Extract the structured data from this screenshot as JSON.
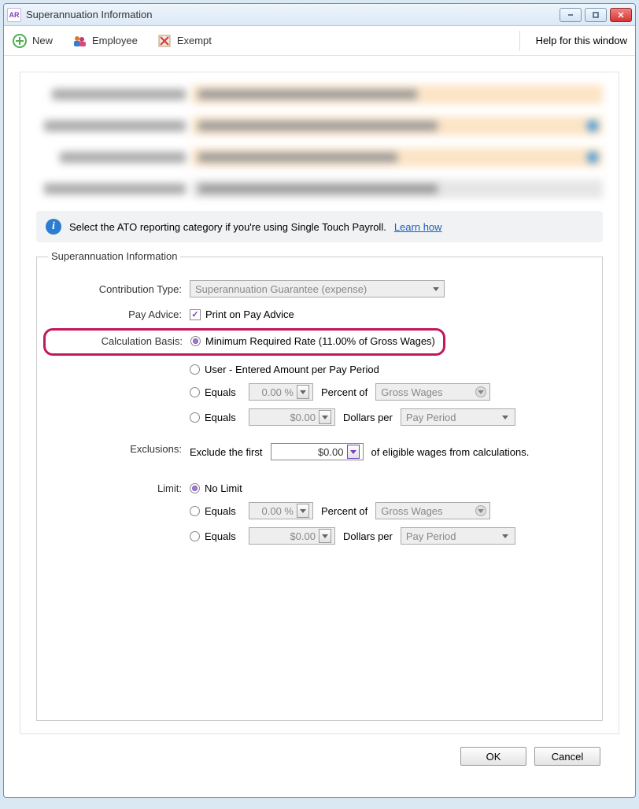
{
  "window": {
    "title": "Superannuation Information",
    "appicon": "AR"
  },
  "toolbar": {
    "new_label": "New",
    "employee_label": "Employee",
    "exempt_label": "Exempt",
    "help_label": "Help for this window"
  },
  "info": {
    "text": "Select the ATO reporting category if you're using Single Touch Payroll.",
    "link": "Learn how"
  },
  "section": {
    "legend": "Superannuation Information",
    "contribution_type_label": "Contribution Type:",
    "contribution_type_value": "Superannuation Guarantee (expense)",
    "pay_advice_label": "Pay Advice:",
    "print_on_pay_advice": "Print on Pay Advice",
    "calc_basis_label": "Calculation Basis:",
    "calc_min_rate": "Minimum Required Rate (11.00% of Gross Wages)",
    "calc_user_entered": "User - Entered Amount per Pay Period",
    "equals": "Equals",
    "percent_value": "0.00 %",
    "percent_of": "Percent of",
    "gross_wages": "Gross Wages",
    "dollars_value": "$0.00",
    "dollars_per": "Dollars per",
    "pay_period": "Pay Period",
    "exclusions_label": "Exclusions:",
    "exclusions_pre": "Exclude the first",
    "exclusions_value": "$0.00",
    "exclusions_post": "of eligible wages from calculations.",
    "limit_label": "Limit:",
    "no_limit": "No Limit"
  },
  "buttons": {
    "ok": "OK",
    "cancel": "Cancel"
  }
}
